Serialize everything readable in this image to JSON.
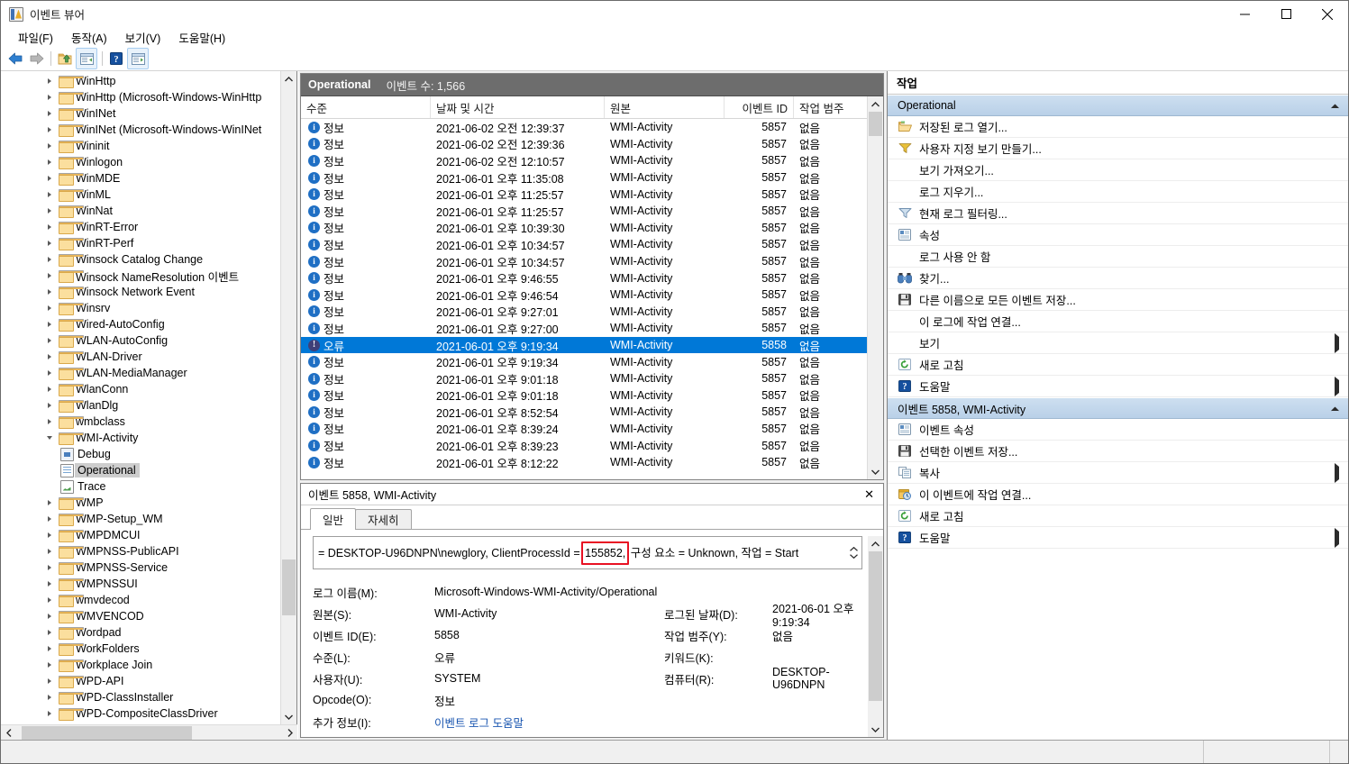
{
  "window": {
    "title": "이벤트 뷰어",
    "icon": "event-viewer-icon",
    "minimize": "─",
    "maximize": "□",
    "close": "✕"
  },
  "menubar": {
    "items": [
      {
        "label": "파일(F)",
        "name": "menu-file"
      },
      {
        "label": "동작(A)",
        "name": "menu-action"
      },
      {
        "label": "보기(V)",
        "name": "menu-view"
      },
      {
        "label": "도움말(H)",
        "name": "menu-help"
      }
    ]
  },
  "toolbar": {
    "buttons": [
      {
        "name": "back-icon",
        "label": "뒤로"
      },
      {
        "name": "forward-icon",
        "label": "앞으로"
      },
      {
        "name": "up-folder-icon",
        "label": "위로"
      },
      {
        "name": "show-tree-pane-icon",
        "label": "콘솔 트리 표시"
      },
      {
        "name": "help-icon",
        "label": "도움말"
      },
      {
        "name": "show-action-pane-icon",
        "label": "작업 창 표시"
      }
    ]
  },
  "tree": {
    "nodes": [
      {
        "label": "WinHttp",
        "type": "folder",
        "level": 1,
        "expandable": true
      },
      {
        "label": "WinHttp (Microsoft-Windows-WinHttp",
        "type": "folder",
        "level": 1,
        "expandable": true
      },
      {
        "label": "WinINet",
        "type": "folder",
        "level": 1,
        "expandable": true
      },
      {
        "label": "WinINet (Microsoft-Windows-WinINet",
        "type": "folder",
        "level": 1,
        "expandable": true
      },
      {
        "label": "Wininit",
        "type": "folder",
        "level": 1,
        "expandable": true
      },
      {
        "label": "Winlogon",
        "type": "folder",
        "level": 1,
        "expandable": true
      },
      {
        "label": "WinMDE",
        "type": "folder",
        "level": 1,
        "expandable": true
      },
      {
        "label": "WinML",
        "type": "folder",
        "level": 1,
        "expandable": true
      },
      {
        "label": "WinNat",
        "type": "folder",
        "level": 1,
        "expandable": true
      },
      {
        "label": "WinRT-Error",
        "type": "folder",
        "level": 1,
        "expandable": true
      },
      {
        "label": "WinRT-Perf",
        "type": "folder",
        "level": 1,
        "expandable": true
      },
      {
        "label": "Winsock Catalog Change",
        "type": "folder",
        "level": 1,
        "expandable": true
      },
      {
        "label": "Winsock NameResolution 이벤트",
        "type": "folder",
        "level": 1,
        "expandable": true
      },
      {
        "label": "Winsock Network Event",
        "type": "folder",
        "level": 1,
        "expandable": true
      },
      {
        "label": "Winsrv",
        "type": "folder",
        "level": 1,
        "expandable": true
      },
      {
        "label": "Wired-AutoConfig",
        "type": "folder",
        "level": 1,
        "expandable": true
      },
      {
        "label": "WLAN-AutoConfig",
        "type": "folder",
        "level": 1,
        "expandable": true
      },
      {
        "label": "WLAN-Driver",
        "type": "folder",
        "level": 1,
        "expandable": true
      },
      {
        "label": "WLAN-MediaManager",
        "type": "folder",
        "level": 1,
        "expandable": true
      },
      {
        "label": "WlanConn",
        "type": "folder",
        "level": 1,
        "expandable": true
      },
      {
        "label": "WlanDlg",
        "type": "folder",
        "level": 1,
        "expandable": true
      },
      {
        "label": "wmbclass",
        "type": "folder",
        "level": 1,
        "expandable": true
      },
      {
        "label": "WMI-Activity",
        "type": "folder",
        "level": 1,
        "expandable": true,
        "expanded": true
      },
      {
        "label": "Debug",
        "type": "log-debug",
        "level": 2
      },
      {
        "label": "Operational",
        "type": "log",
        "level": 2,
        "selected": true
      },
      {
        "label": "Trace",
        "type": "log-trace",
        "level": 2
      },
      {
        "label": "WMP",
        "type": "folder",
        "level": 1,
        "expandable": true
      },
      {
        "label": "WMP-Setup_WM",
        "type": "folder",
        "level": 1,
        "expandable": true
      },
      {
        "label": "WMPDMCUI",
        "type": "folder",
        "level": 1,
        "expandable": true
      },
      {
        "label": "WMPNSS-PublicAPI",
        "type": "folder",
        "level": 1,
        "expandable": true
      },
      {
        "label": "WMPNSS-Service",
        "type": "folder",
        "level": 1,
        "expandable": true
      },
      {
        "label": "WMPNSSUI",
        "type": "folder",
        "level": 1,
        "expandable": true
      },
      {
        "label": "wmvdecod",
        "type": "folder",
        "level": 1,
        "expandable": true
      },
      {
        "label": "WMVENCOD",
        "type": "folder",
        "level": 1,
        "expandable": true
      },
      {
        "label": "Wordpad",
        "type": "folder",
        "level": 1,
        "expandable": true
      },
      {
        "label": "WorkFolders",
        "type": "folder",
        "level": 1,
        "expandable": true
      },
      {
        "label": "Workplace Join",
        "type": "folder",
        "level": 1,
        "expandable": true
      },
      {
        "label": "WPD-API",
        "type": "folder",
        "level": 1,
        "expandable": true
      },
      {
        "label": "WPD-ClassInstaller",
        "type": "folder",
        "level": 1,
        "expandable": true
      },
      {
        "label": "WPD-CompositeClassDriver",
        "type": "folder",
        "level": 1,
        "expandable": true
      }
    ]
  },
  "eventlist": {
    "log_name": "Operational",
    "count_label": "이벤트 수: 1,566",
    "columns": [
      {
        "label": "수준",
        "name": "column-level"
      },
      {
        "label": "날짜 및 시간",
        "name": "column-datetime"
      },
      {
        "label": "원본",
        "name": "column-source"
      },
      {
        "label": "이벤트 ID",
        "name": "column-event-id"
      },
      {
        "label": "작업 범주",
        "name": "column-task-category"
      }
    ],
    "rows": [
      {
        "level": "정보",
        "sev": "info",
        "datetime": "2021-06-02 오전 12:39:37",
        "source": "WMI-Activity",
        "event_id": "5857",
        "task": "없음"
      },
      {
        "level": "정보",
        "sev": "info",
        "datetime": "2021-06-02 오전 12:39:36",
        "source": "WMI-Activity",
        "event_id": "5857",
        "task": "없음"
      },
      {
        "level": "정보",
        "sev": "info",
        "datetime": "2021-06-02 오전 12:10:57",
        "source": "WMI-Activity",
        "event_id": "5857",
        "task": "없음"
      },
      {
        "level": "정보",
        "sev": "info",
        "datetime": "2021-06-01 오후 11:35:08",
        "source": "WMI-Activity",
        "event_id": "5857",
        "task": "없음"
      },
      {
        "level": "정보",
        "sev": "info",
        "datetime": "2021-06-01 오후 11:25:57",
        "source": "WMI-Activity",
        "event_id": "5857",
        "task": "없음"
      },
      {
        "level": "정보",
        "sev": "info",
        "datetime": "2021-06-01 오후 11:25:57",
        "source": "WMI-Activity",
        "event_id": "5857",
        "task": "없음"
      },
      {
        "level": "정보",
        "sev": "info",
        "datetime": "2021-06-01 오후 10:39:30",
        "source": "WMI-Activity",
        "event_id": "5857",
        "task": "없음"
      },
      {
        "level": "정보",
        "sev": "info",
        "datetime": "2021-06-01 오후 10:34:57",
        "source": "WMI-Activity",
        "event_id": "5857",
        "task": "없음"
      },
      {
        "level": "정보",
        "sev": "info",
        "datetime": "2021-06-01 오후 10:34:57",
        "source": "WMI-Activity",
        "event_id": "5857",
        "task": "없음"
      },
      {
        "level": "정보",
        "sev": "info",
        "datetime": "2021-06-01 오후 9:46:55",
        "source": "WMI-Activity",
        "event_id": "5857",
        "task": "없음"
      },
      {
        "level": "정보",
        "sev": "info",
        "datetime": "2021-06-01 오후 9:46:54",
        "source": "WMI-Activity",
        "event_id": "5857",
        "task": "없음"
      },
      {
        "level": "정보",
        "sev": "info",
        "datetime": "2021-06-01 오후 9:27:01",
        "source": "WMI-Activity",
        "event_id": "5857",
        "task": "없음"
      },
      {
        "level": "정보",
        "sev": "info",
        "datetime": "2021-06-01 오후 9:27:00",
        "source": "WMI-Activity",
        "event_id": "5857",
        "task": "없음"
      },
      {
        "level": "오류",
        "sev": "err",
        "datetime": "2021-06-01 오후 9:19:34",
        "source": "WMI-Activity",
        "event_id": "5858",
        "task": "없음",
        "selected": true
      },
      {
        "level": "정보",
        "sev": "info",
        "datetime": "2021-06-01 오후 9:19:34",
        "source": "WMI-Activity",
        "event_id": "5857",
        "task": "없음"
      },
      {
        "level": "정보",
        "sev": "info",
        "datetime": "2021-06-01 오후 9:01:18",
        "source": "WMI-Activity",
        "event_id": "5857",
        "task": "없음"
      },
      {
        "level": "정보",
        "sev": "info",
        "datetime": "2021-06-01 오후 9:01:18",
        "source": "WMI-Activity",
        "event_id": "5857",
        "task": "없음"
      },
      {
        "level": "정보",
        "sev": "info",
        "datetime": "2021-06-01 오후 8:52:54",
        "source": "WMI-Activity",
        "event_id": "5857",
        "task": "없음"
      },
      {
        "level": "정보",
        "sev": "info",
        "datetime": "2021-06-01 오후 8:39:24",
        "source": "WMI-Activity",
        "event_id": "5857",
        "task": "없음"
      },
      {
        "level": "정보",
        "sev": "info",
        "datetime": "2021-06-01 오후 8:39:23",
        "source": "WMI-Activity",
        "event_id": "5857",
        "task": "없음"
      },
      {
        "level": "정보",
        "sev": "info",
        "datetime": "2021-06-01 오후 8:12:22",
        "source": "WMI-Activity",
        "event_id": "5857",
        "task": "없음"
      }
    ]
  },
  "detail": {
    "header": "이벤트 5858, WMI-Activity",
    "close": "✕",
    "tabs": [
      {
        "label": "일반",
        "name": "tab-general",
        "active": true
      },
      {
        "label": "자세히",
        "name": "tab-details",
        "active": false
      }
    ],
    "message_prefix": "= DESKTOP-U96DNPN\\newglory, ClientProcessId = ",
    "message_highlight": "155852,",
    "message_suffix": " 구성 요소 = Unknown, 작업 = Start",
    "highlight_color": "#e81123",
    "fields": [
      {
        "label": "로그 이름(M):",
        "value": "Microsoft-Windows-WMI-Activity/Operational"
      },
      {
        "label": "원본(S):",
        "value": "WMI-Activity",
        "label2": "로그된 날짜(D):",
        "value2": "2021-06-01 오후 9:19:34"
      },
      {
        "label": "이벤트 ID(E):",
        "value": "5858",
        "label2": "작업 범주(Y):",
        "value2": "없음"
      },
      {
        "label": "수준(L):",
        "value": "오류",
        "label2": "키워드(K):",
        "value2": ""
      },
      {
        "label": "사용자(U):",
        "value": "SYSTEM",
        "label2": "컴퓨터(R):",
        "value2": "DESKTOP-U96DNPN"
      },
      {
        "label": "Opcode(O):",
        "value": "정보"
      },
      {
        "label": "추가 정보(I):",
        "value": "이벤트 로그 도움말",
        "link": true
      }
    ]
  },
  "actions": {
    "title": "작업",
    "groups": [
      {
        "header": "Operational",
        "name": "actions-group-operational",
        "items": [
          {
            "label": "저장된 로그 열기...",
            "icon": "open-folder-icon"
          },
          {
            "label": "사용자 지정 보기 만들기...",
            "icon": "filter-yellow-icon"
          },
          {
            "label": "보기 가져오기...",
            "icon": null
          },
          {
            "label": "로그 지우기...",
            "icon": null
          },
          {
            "label": "현재 로그 필터링...",
            "icon": "filter-icon"
          },
          {
            "label": "속성",
            "icon": "properties-icon"
          },
          {
            "label": "로그 사용 안 함",
            "icon": null
          },
          {
            "label": "찾기...",
            "icon": "binoculars-icon"
          },
          {
            "label": "다른 이름으로 모든 이벤트 저장...",
            "icon": "save-icon"
          },
          {
            "label": "이 로그에 작업 연결...",
            "icon": null
          },
          {
            "label": "보기",
            "icon": null,
            "submenu": true
          },
          {
            "label": "새로 고침",
            "icon": "refresh-icon"
          },
          {
            "label": "도움말",
            "icon": "help-icon",
            "submenu": true
          }
        ]
      },
      {
        "header": "이벤트 5858, WMI-Activity",
        "name": "actions-group-event",
        "items": [
          {
            "label": "이벤트 속성",
            "icon": "properties-icon"
          },
          {
            "label": "선택한 이벤트 저장...",
            "icon": "save-icon"
          },
          {
            "label": "복사",
            "icon": "copy-icon",
            "submenu": true
          },
          {
            "label": "이 이벤트에 작업 연결...",
            "icon": "attach-task-icon"
          },
          {
            "label": "새로 고침",
            "icon": "refresh-icon"
          },
          {
            "label": "도움말",
            "icon": "help-icon",
            "submenu": true
          }
        ]
      }
    ]
  }
}
